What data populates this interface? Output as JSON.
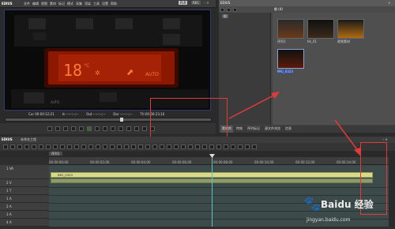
{
  "player": {
    "app_name": "EDIUS",
    "mode_badge": "PLR",
    "rec_badge": "REC",
    "menu": [
      "文件",
      "编辑",
      "视图",
      "素材",
      "标记",
      "模式",
      "采集",
      "渲染",
      "工具",
      "设置",
      "帮助"
    ],
    "display_text": "18",
    "display_unit": "°C",
    "display_auto": "AUTO",
    "panel_label": "AUTO",
    "timecode_cur": "Cur 00:00:12;21",
    "timecode_in": "In --:--:--;--",
    "timecode_out": "Out --:--:--;--",
    "timecode_dur": "Dur --:--:--;--",
    "timecode_ttl": "Ttl 00:00:23;10"
  },
  "bin": {
    "title": "EDIUS",
    "folder": "根",
    "tab_label": "根 (4)",
    "clips": [
      {
        "name": "序列1"
      },
      {
        "name": "hk_01"
      },
      {
        "name": "视频素材"
      },
      {
        "name": "IMG_0323"
      }
    ],
    "bottom_tabs": [
      "素材库",
      "特效",
      "序列标记",
      "源文件浏览",
      "信息"
    ]
  },
  "timeline": {
    "title": "EDIUS",
    "project": "未命名工程",
    "sequence_tab": "序列1",
    "ruler_labels": [
      "00:00:00;00",
      "00:00:02;00",
      "00:00:04;00",
      "00:00:06;00",
      "00:00:08;00",
      "00:00:10;00",
      "00:00:12;00",
      "00:00:14;00",
      "00:00:16;00",
      "00:00:18;00",
      "00:00:20;00"
    ],
    "clip_name": "IMG_0323",
    "tracks": [
      "1 VA",
      "2 V",
      "1 T",
      "1 A",
      "2 A",
      "3 A",
      "4 A"
    ]
  },
  "watermark": {
    "site": "jingyan.baidu.com",
    "brand": "Baidu 经验"
  },
  "colors": {
    "accent_red": "#e23a3a",
    "display_orange": "#ff4a1a",
    "clip_yellow": "#d9d98a",
    "audio_green": "#8b9b6a",
    "timeline_bg": "#3c4a4a"
  }
}
